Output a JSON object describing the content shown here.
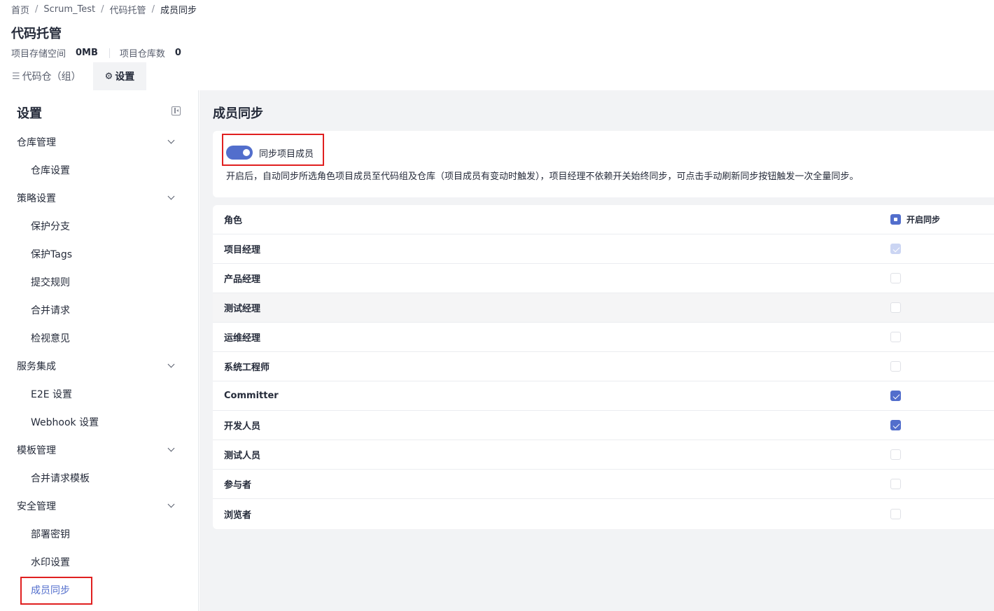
{
  "breadcrumb": [
    "首页",
    "Scrum_Test",
    "代码托管",
    "成员同步"
  ],
  "page_title": "代码托管",
  "stats": {
    "storage_label": "项目存储空间",
    "storage_value": "0MB",
    "repo_count_label": "项目仓库数",
    "repo_count_value": "0"
  },
  "tabs": [
    {
      "icon": "list-icon",
      "label": "代码仓（组）",
      "active": false
    },
    {
      "icon": "gear-icon",
      "label": "设置",
      "active": true
    }
  ],
  "sidebar": {
    "title": "设置",
    "nav": [
      {
        "type": "group",
        "label": "仓库管理"
      },
      {
        "type": "item",
        "label": "仓库设置"
      },
      {
        "type": "group",
        "label": "策略设置"
      },
      {
        "type": "item",
        "label": "保护分支"
      },
      {
        "type": "item",
        "label": "保护Tags"
      },
      {
        "type": "item",
        "label": "提交规则"
      },
      {
        "type": "item",
        "label": "合并请求"
      },
      {
        "type": "item",
        "label": "检视意见"
      },
      {
        "type": "group",
        "label": "服务集成"
      },
      {
        "type": "item",
        "label": "E2E 设置"
      },
      {
        "type": "item",
        "label": "Webhook 设置"
      },
      {
        "type": "group",
        "label": "模板管理"
      },
      {
        "type": "item",
        "label": "合并请求模板"
      },
      {
        "type": "group",
        "label": "安全管理"
      },
      {
        "type": "item",
        "label": "部署密钥"
      },
      {
        "type": "item",
        "label": "水印设置"
      },
      {
        "type": "item",
        "label": "成员同步",
        "active": true
      }
    ]
  },
  "main": {
    "title": "成员同步",
    "sync_toggle": {
      "label": "同步项目成员",
      "on": true
    },
    "description": "开启后，自动同步所选角色项目成员至代码组及仓库（项目成员有变动时触发），项目经理不依赖开关始终同步，可点击手动刷新同步按钮触发一次全量同步。",
    "table": {
      "header_role": "角色",
      "header_sync": "开启同步",
      "rows": [
        {
          "role": "项目经理",
          "state": "disabled-checked"
        },
        {
          "role": "产品经理",
          "state": "unchecked"
        },
        {
          "role": "测试经理",
          "state": "unchecked"
        },
        {
          "role": "运维经理",
          "state": "unchecked"
        },
        {
          "role": "系统工程师",
          "state": "unchecked"
        },
        {
          "role": "Committer",
          "state": "checked"
        },
        {
          "role": "开发人员",
          "state": "checked"
        },
        {
          "role": "测试人员",
          "state": "unchecked"
        },
        {
          "role": "参与者",
          "state": "unchecked"
        },
        {
          "role": "浏览者",
          "state": "unchecked"
        }
      ]
    }
  },
  "colors": {
    "accent": "#526ecc",
    "highlight": "#e02020",
    "main_bg": "#f2f3f5"
  }
}
